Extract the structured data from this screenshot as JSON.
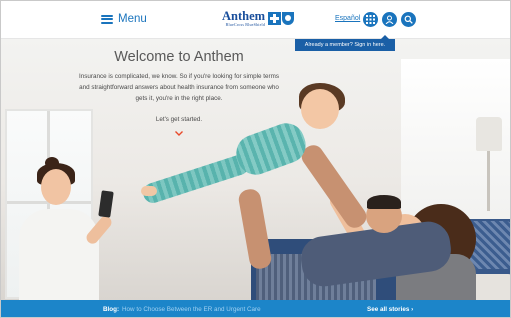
{
  "header": {
    "menu_label": "Menu",
    "logo_name": "Anthem",
    "logo_subtitle": "BlueCross BlueShield",
    "language_link": "Español",
    "icons": [
      "grid-icon",
      "user-icon",
      "search-icon"
    ],
    "signin_tooltip": "Already a member? Sign in here."
  },
  "hero": {
    "title": "Welcome to Anthem",
    "body": "Insurance is complicated, we know. So if you're looking for simple terms and straightforward answers about health insurance from someone who gets it, you're in the right place.",
    "cta": "Let's get started."
  },
  "blog_bar": {
    "label": "Blog:",
    "link": "How to Choose Between the ER and Urgent Care",
    "see_all": "See all stories ›"
  },
  "colors": {
    "brand_blue": "#1a74bd",
    "blog_bar": "#1c85c9",
    "tooltip": "#1a5fa6",
    "chevron": "#e8492a"
  }
}
